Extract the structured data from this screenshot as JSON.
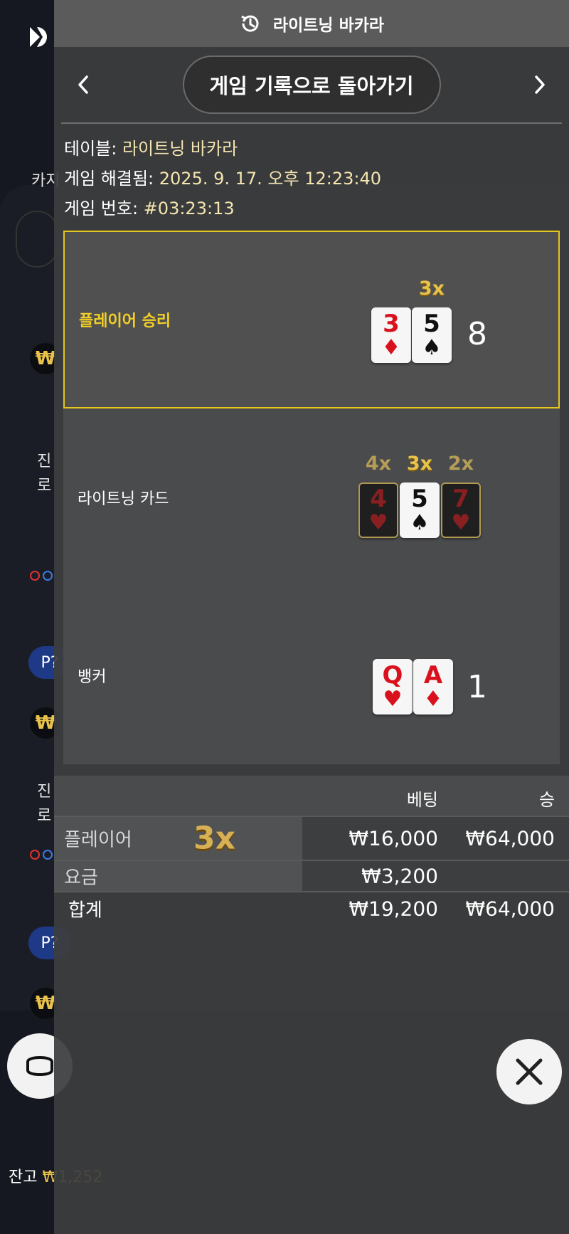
{
  "background": {
    "labels": [
      "카지",
      "진",
      "로",
      "진",
      "로"
    ],
    "pill_label": "P?",
    "won_symbol": "₩",
    "balance_label": "잔고",
    "balance_value": "₩1,252"
  },
  "header": {
    "title": "라이트닝 바카라",
    "icon": "history-icon"
  },
  "nav": {
    "back_label": "게임 기록으로 돌아가기",
    "prev_icon": "chevron-left-icon",
    "next_icon": "chevron-right-icon"
  },
  "info": {
    "table_label": "테이블:",
    "table_value": "라이트닝 바카라",
    "resolved_label": "게임 해결됨:",
    "resolved_value": "2025. 9. 17. 오후 12:23:40",
    "round_label": "게임 번호:",
    "round_value": "#03:23:13"
  },
  "outcomes": {
    "player": {
      "label": "플레이어 승리",
      "cards": [
        {
          "rank": "3",
          "suit": "♦",
          "color": "red"
        },
        {
          "rank": "5",
          "suit": "♠",
          "color": "black",
          "multiplier": "3x"
        }
      ],
      "score": "8"
    },
    "lightning": {
      "label": "라이트닝 카드",
      "cards": [
        {
          "rank": "4",
          "suit": "♥",
          "multiplier": "4x",
          "active": false
        },
        {
          "rank": "5",
          "suit": "♠",
          "multiplier": "3x",
          "active": true
        },
        {
          "rank": "7",
          "suit": "♥",
          "multiplier": "2x",
          "active": false
        }
      ]
    },
    "banker": {
      "label": "뱅커",
      "cards": [
        {
          "rank": "Q",
          "suit": "♥",
          "color": "red"
        },
        {
          "rank": "A",
          "suit": "♦",
          "color": "red"
        }
      ],
      "score": "1"
    }
  },
  "bets": {
    "col_bet": "베팅",
    "col_win": "승",
    "rows": [
      {
        "name": "플레이어",
        "multiplier": "3x",
        "bet": "₩16,000",
        "win": "₩64,000"
      },
      {
        "name": "요금",
        "bet": "₩3,200",
        "win": ""
      }
    ],
    "total": {
      "name": "합계",
      "bet": "₩19,200",
      "win": "₩64,000"
    }
  },
  "close_icon": "close-icon",
  "colors": {
    "highlight": "#e5c61c",
    "gold": "#e8c24a",
    "red_suit": "#d8111c",
    "info_value": "#f4e5b0"
  }
}
